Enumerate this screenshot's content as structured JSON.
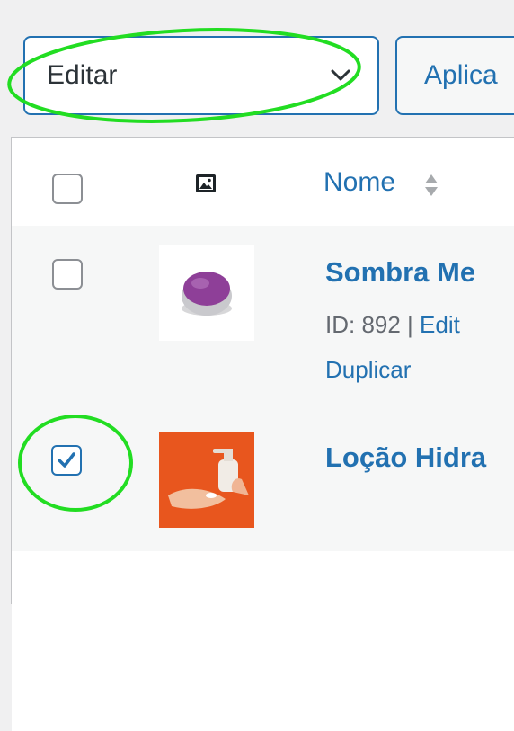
{
  "bulk_actions": {
    "selected": "Editar",
    "apply_label": "Aplica"
  },
  "table": {
    "header": {
      "image_icon": "image-icon",
      "name_label": "Nome",
      "sort_icon": "sort-arrows-icon"
    },
    "rows": [
      {
        "title": "Sombra Me",
        "id_text": "ID: 892 | ",
        "edit_link": "Edit",
        "duplicate_link": "Duplicar",
        "checked": false,
        "thumbnail": "purple eyeshadow pot"
      },
      {
        "title": "Loção Hidra",
        "checked": true,
        "thumbnail": "hands with lotion on orange background"
      }
    ]
  },
  "colors": {
    "accent": "#2271b1",
    "annotation": "#22dd22",
    "row_alt_bg": "#f6f7f7",
    "page_bg": "#f0f0f1"
  }
}
